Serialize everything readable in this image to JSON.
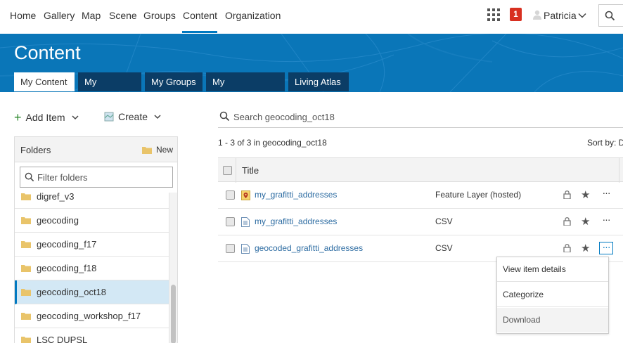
{
  "nav": {
    "items": [
      "Home",
      "Gallery",
      "Map",
      "Scene",
      "Groups",
      "Content",
      "Organization"
    ],
    "active": "Content",
    "notification_count": "1",
    "user_name": "Patricia"
  },
  "banner": {
    "title": "Content",
    "tabs": [
      "My Content",
      "My Favorites",
      "My Groups",
      "My Organization",
      "Living Atlas"
    ],
    "active_tab": "My Content"
  },
  "toolbar": {
    "add_item_label": "Add Item",
    "create_label": "Create"
  },
  "folders": {
    "title": "Folders",
    "new_label": "New",
    "filter_placeholder": "Filter folders",
    "items": [
      "digref_v3",
      "geocoding",
      "geocoding_f17",
      "geocoding_f18",
      "geocoding_oct18",
      "geocoding_workshop_f17",
      "LSC DUPSL"
    ],
    "selected": "geocoding_oct18"
  },
  "main": {
    "search_placeholder": "Search geocoding_oct18",
    "result_count": "1 - 3 of 3 in geocoding_oct18",
    "sort_label": "Sort by: D",
    "column_title": "Title",
    "rows": [
      {
        "title": "my_grafitti_addresses",
        "type": "Feature Layer (hosted)",
        "icon": "feature-layer-icon"
      },
      {
        "title": "my_grafitti_addresses",
        "type": "CSV",
        "icon": "csv-file-icon"
      },
      {
        "title": "geocoded_grafitti_addresses",
        "type": "CSV",
        "icon": "csv-file-icon"
      }
    ]
  },
  "menu": {
    "items": [
      "View item details",
      "Categorize",
      "Download"
    ]
  },
  "colors": {
    "accent": "#0079c1",
    "banner": "#0a76b8",
    "tab_dark": "#0b3d66",
    "badge": "#d83020",
    "link": "#2d6ca2",
    "selected_folder": "#d3e8f5"
  }
}
